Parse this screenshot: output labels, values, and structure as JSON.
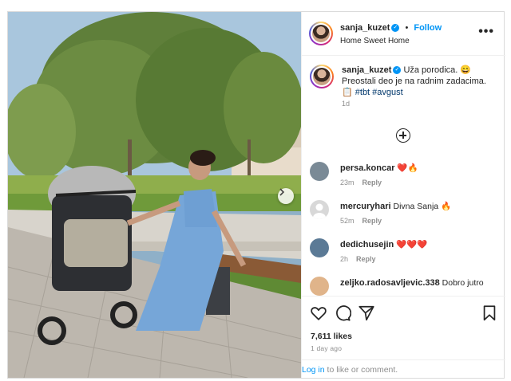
{
  "post": {
    "author": "sanja_kuzet",
    "follow_label": "Follow",
    "location": "Home Sweet Home",
    "more_label": "•••",
    "photo_alt": "Woman in blue dress sitting on bench next to stroller"
  },
  "caption": {
    "author": "sanja_kuzet",
    "text_1": "Uža porodica. 😄",
    "text_2": "Preostali deo je na radnim zadacima.",
    "emoji": "📋",
    "tags": "#tbt #avgust",
    "time": "1d"
  },
  "comments": [
    {
      "user": "persa.koncar",
      "text": "❤️🔥",
      "time": "23m",
      "reply": "Reply",
      "avatar_color": "#7a8a96"
    },
    {
      "user": "mercuryhari",
      "text": "Divna Sanja 🔥",
      "time": "52m",
      "reply": "Reply",
      "avatar_color": "#d8d8d8"
    },
    {
      "user": "dedichusejin",
      "text": "❤️❤️❤️",
      "time": "2h",
      "reply": "Reply",
      "avatar_color": "#5b7a96"
    },
    {
      "user": "zeljko.radosavljevic.338",
      "text": "Dobro jutro",
      "time": "",
      "reply": "",
      "avatar_color": "#e0b48a"
    }
  ],
  "engagement": {
    "likes": "7,611 likes",
    "ago": "1 day ago"
  },
  "login": {
    "link": "Log in",
    "rest": " to like or comment."
  },
  "icons": {
    "like": "heart-icon",
    "comment": "comment-icon",
    "share": "send-icon",
    "save": "bookmark-icon",
    "more": "more-icon",
    "add": "plus-circle-icon",
    "next": "chevron-right-icon"
  },
  "colors": {
    "accent": "#0095f6",
    "hashtag": "#00376b",
    "muted": "#8e8e8e",
    "heart": "#ed4956"
  }
}
